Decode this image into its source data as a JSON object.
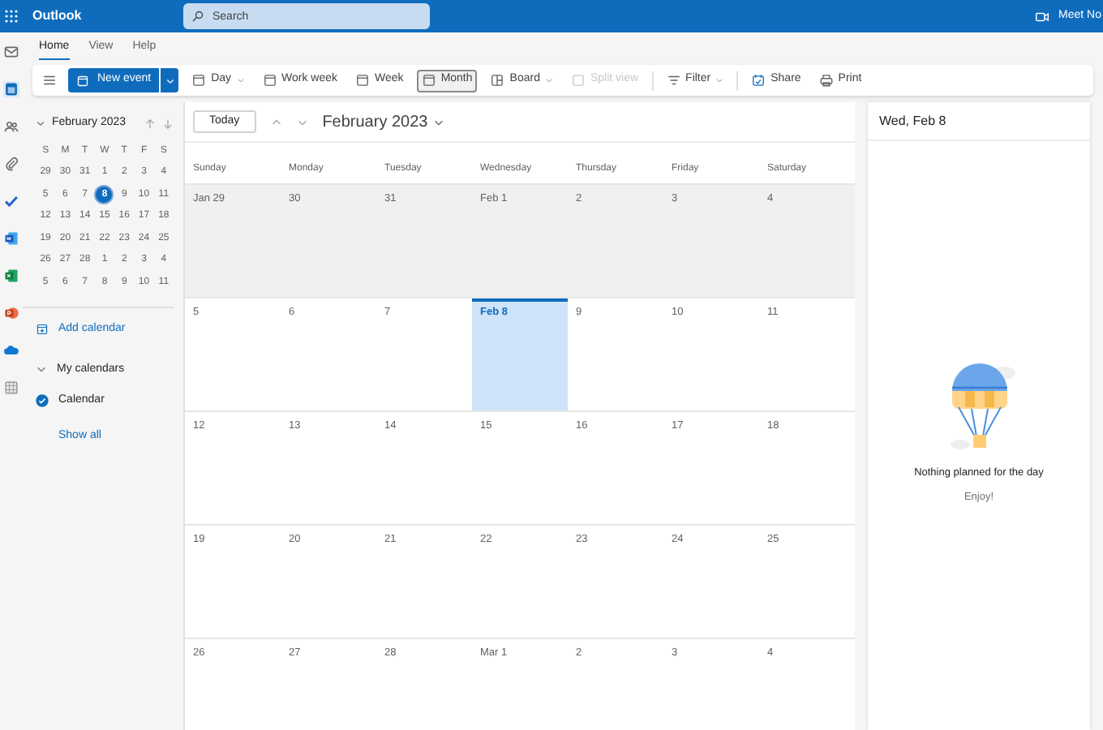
{
  "top_bar": {
    "app_name": "Outlook",
    "search": {
      "placeholder": "Search"
    },
    "meet_now": "Meet No"
  },
  "rail": [
    {
      "kind": "mail",
      "selected": false
    },
    {
      "kind": "calendar",
      "selected": true
    },
    {
      "kind": "people",
      "selected": false
    },
    {
      "kind": "attach",
      "selected": false
    },
    {
      "kind": "todo",
      "selected": false
    },
    {
      "kind": "word",
      "selected": false
    },
    {
      "kind": "excel",
      "selected": false
    },
    {
      "kind": "powerpoint",
      "selected": false
    },
    {
      "kind": "onedrive",
      "selected": false
    },
    {
      "kind": "apps",
      "selected": false
    }
  ],
  "tabs": [
    {
      "label": "Home",
      "selected": true
    },
    {
      "label": "View",
      "selected": false
    },
    {
      "label": "Help",
      "selected": false
    }
  ],
  "toolbar": {
    "new_event": "New event",
    "items": [
      {
        "kind": "day",
        "label": "Day",
        "dropdown": true,
        "selected": false,
        "disabled": false
      },
      {
        "kind": "workweek",
        "label": "Work week",
        "dropdown": false,
        "selected": false,
        "disabled": false
      },
      {
        "kind": "week",
        "label": "Week",
        "dropdown": false,
        "selected": false,
        "disabled": false
      },
      {
        "kind": "month",
        "label": "Month",
        "dropdown": false,
        "selected": true,
        "disabled": false
      },
      {
        "kind": "board",
        "label": "Board",
        "dropdown": true,
        "selected": false,
        "disabled": false
      },
      {
        "kind": "split",
        "label": "Split view",
        "dropdown": false,
        "selected": false,
        "disabled": true
      },
      {
        "kind": "filter",
        "label": "Filter",
        "dropdown": true,
        "selected": false,
        "disabled": false
      },
      {
        "kind": "share",
        "label": "Share",
        "dropdown": false,
        "selected": false,
        "disabled": false
      },
      {
        "kind": "print",
        "label": "Print",
        "dropdown": false,
        "selected": false,
        "disabled": false
      }
    ]
  },
  "mini_calendar": {
    "title": "February 2023",
    "weekdays": [
      "S",
      "M",
      "T",
      "W",
      "T",
      "F",
      "S"
    ],
    "weeks": [
      [
        {
          "label": "29",
          "selected": false
        },
        {
          "label": "30",
          "selected": false
        },
        {
          "label": "31",
          "selected": false
        },
        {
          "label": "1",
          "selected": false
        },
        {
          "label": "2",
          "selected": false
        },
        {
          "label": "3",
          "selected": false
        },
        {
          "label": "4",
          "selected": false
        }
      ],
      [
        {
          "label": "5",
          "selected": false
        },
        {
          "label": "6",
          "selected": false
        },
        {
          "label": "7",
          "selected": false
        },
        {
          "label": "8",
          "selected": true
        },
        {
          "label": "9",
          "selected": false
        },
        {
          "label": "10",
          "selected": false
        },
        {
          "label": "11",
          "selected": false
        }
      ],
      [
        {
          "label": "12",
          "selected": false
        },
        {
          "label": "13",
          "selected": false
        },
        {
          "label": "14",
          "selected": false
        },
        {
          "label": "15",
          "selected": false
        },
        {
          "label": "16",
          "selected": false
        },
        {
          "label": "17",
          "selected": false
        },
        {
          "label": "18",
          "selected": false
        }
      ],
      [
        {
          "label": "19",
          "selected": false
        },
        {
          "label": "20",
          "selected": false
        },
        {
          "label": "21",
          "selected": false
        },
        {
          "label": "22",
          "selected": false
        },
        {
          "label": "23",
          "selected": false
        },
        {
          "label": "24",
          "selected": false
        },
        {
          "label": "25",
          "selected": false
        }
      ],
      [
        {
          "label": "26",
          "selected": false
        },
        {
          "label": "27",
          "selected": false
        },
        {
          "label": "28",
          "selected": false
        },
        {
          "label": "1",
          "selected": false
        },
        {
          "label": "2",
          "selected": false
        },
        {
          "label": "3",
          "selected": false
        },
        {
          "label": "4",
          "selected": false
        }
      ],
      [
        {
          "label": "5",
          "selected": false
        },
        {
          "label": "6",
          "selected": false
        },
        {
          "label": "7",
          "selected": false
        },
        {
          "label": "8",
          "selected": false
        },
        {
          "label": "9",
          "selected": false
        },
        {
          "label": "10",
          "selected": false
        },
        {
          "label": "11",
          "selected": false
        }
      ]
    ]
  },
  "sidebar": {
    "add_calendar": "Add calendar",
    "group": {
      "label": "My calendars",
      "expanded": true,
      "items": [
        {
          "label": "Calendar",
          "checked": true
        }
      ]
    },
    "show_all": "Show all"
  },
  "calendar": {
    "today_button": "Today",
    "title": "February 2023",
    "weekdays": [
      "Sunday",
      "Monday",
      "Tuesday",
      "Wednesday",
      "Thursday",
      "Friday",
      "Saturday"
    ],
    "weeks": [
      {
        "past": true,
        "days": [
          {
            "label": "Jan 29",
            "selected": false
          },
          {
            "label": "30",
            "selected": false
          },
          {
            "label": "31",
            "selected": false
          },
          {
            "label": "Feb 1",
            "selected": false
          },
          {
            "label": "2",
            "selected": false
          },
          {
            "label": "3",
            "selected": false
          },
          {
            "label": "4",
            "selected": false
          }
        ]
      },
      {
        "past": false,
        "days": [
          {
            "label": "5",
            "selected": false
          },
          {
            "label": "6",
            "selected": false
          },
          {
            "label": "7",
            "selected": false
          },
          {
            "label": "Feb 8",
            "selected": true
          },
          {
            "label": "9",
            "selected": false
          },
          {
            "label": "10",
            "selected": false
          },
          {
            "label": "11",
            "selected": false
          }
        ]
      },
      {
        "past": false,
        "days": [
          {
            "label": "12",
            "selected": false
          },
          {
            "label": "13",
            "selected": false
          },
          {
            "label": "14",
            "selected": false
          },
          {
            "label": "15",
            "selected": false
          },
          {
            "label": "16",
            "selected": false
          },
          {
            "label": "17",
            "selected": false
          },
          {
            "label": "18",
            "selected": false
          }
        ]
      },
      {
        "past": false,
        "days": [
          {
            "label": "19",
            "selected": false
          },
          {
            "label": "20",
            "selected": false
          },
          {
            "label": "21",
            "selected": false
          },
          {
            "label": "22",
            "selected": false
          },
          {
            "label": "23",
            "selected": false
          },
          {
            "label": "24",
            "selected": false
          },
          {
            "label": "25",
            "selected": false
          }
        ]
      },
      {
        "past": false,
        "days": [
          {
            "label": "26",
            "selected": false
          },
          {
            "label": "27",
            "selected": false
          },
          {
            "label": "28",
            "selected": false
          },
          {
            "label": "Mar 1",
            "selected": false
          },
          {
            "label": "2",
            "selected": false
          },
          {
            "label": "3",
            "selected": false
          },
          {
            "label": "4",
            "selected": false
          }
        ]
      }
    ]
  },
  "day_panel": {
    "title": "Wed, Feb 8",
    "message": "Nothing planned for the day",
    "subtitle": "Enjoy!"
  }
}
